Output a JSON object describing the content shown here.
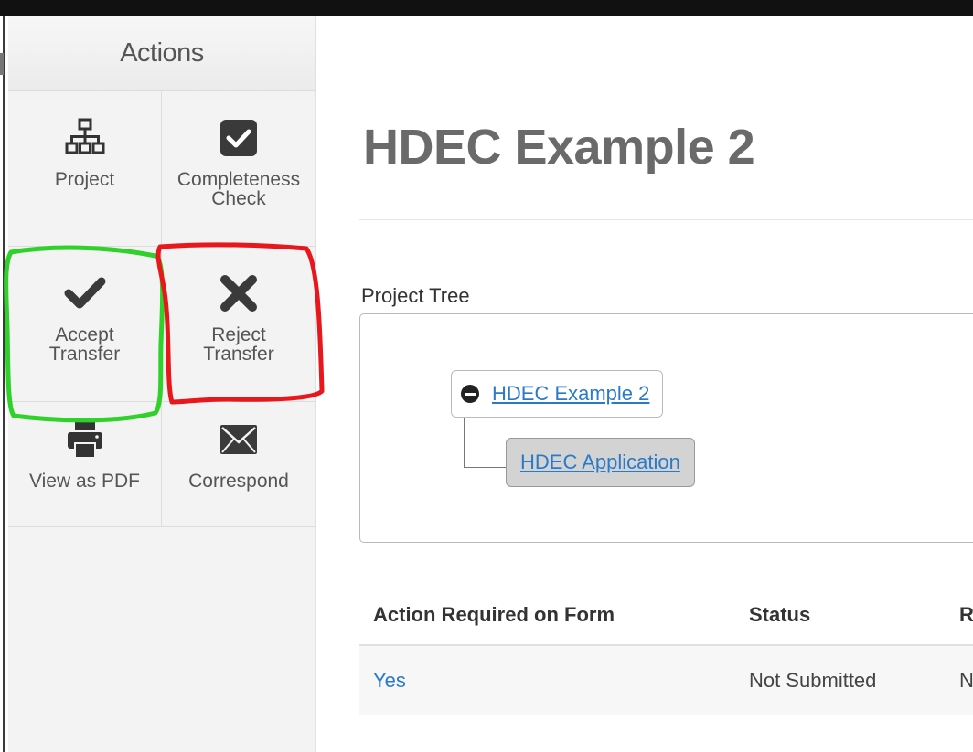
{
  "sidebar": {
    "header": "Actions",
    "tiles": [
      {
        "label_line1": "Project",
        "label_line2": "",
        "icon": "sitemap-icon"
      },
      {
        "label_line1": "Completeness",
        "label_line2": "Check",
        "icon": "checkbox-icon"
      },
      {
        "label_line1": "Accept",
        "label_line2": "Transfer",
        "icon": "check-icon"
      },
      {
        "label_line1": "Reject",
        "label_line2": "Transfer",
        "icon": "x-icon"
      },
      {
        "label_line1": "View as PDF",
        "label_line2": "",
        "icon": "printer-icon"
      },
      {
        "label_line1": "Correspond",
        "label_line2": "",
        "icon": "envelope-icon"
      }
    ]
  },
  "main": {
    "title": "HDEC Example 2",
    "tree": {
      "label": "Project Tree",
      "root": "HDEC Example 2",
      "child": "HDEC Application"
    },
    "table": {
      "headers": [
        "Action Required on Form",
        "Status",
        "R"
      ],
      "rows": [
        [
          "Yes",
          "Not Submitted",
          "N"
        ]
      ]
    }
  },
  "colors": {
    "link": "#2a7ac9",
    "annotation_green": "#2fd12a",
    "annotation_red": "#e8171c",
    "title_gray": "#6a6a6a"
  }
}
